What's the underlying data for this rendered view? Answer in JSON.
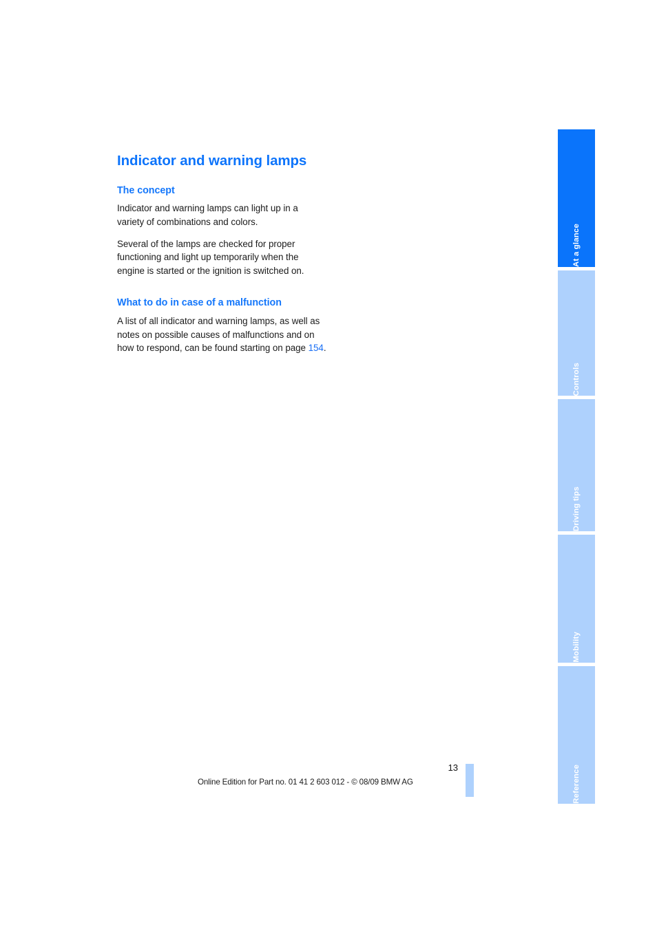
{
  "document": {
    "title": "Indicator and warning lamps",
    "sections": [
      {
        "heading": "The concept",
        "paragraphs": [
          "Indicator and warning lamps can light up in a variety of combinations and colors.",
          "Several of the lamps are checked for proper functioning and light up temporarily when the engine is started or the ignition is switched on."
        ]
      },
      {
        "heading": "What to do in case of a malfunction",
        "paragraph_lead": "A list of all indicator and warning lamps, as well as notes on possible causes of malfunctions and on how to respond, can be found starting on page ",
        "paragraph_ref": "154",
        "paragraph_tail": "."
      }
    ]
  },
  "footer": {
    "page_number": "13",
    "note": "Online Edition for Part no. 01 41 2 603 012 - © 08/09 BMW AG"
  },
  "tabs": [
    {
      "label": "At a glance",
      "active": true
    },
    {
      "label": "Controls",
      "active": false
    },
    {
      "label": "Driving tips",
      "active": false
    },
    {
      "label": "Mobility",
      "active": false
    },
    {
      "label": "Reference",
      "active": false
    }
  ],
  "colors": {
    "accent_blue": "#0d74fb",
    "sub_head_blue": "#1477fb",
    "tab_active": "#0a74fb",
    "tab_inactive": "#aed1fd",
    "body_text": "#1b1b1b",
    "link_blue": "#1a6ff5"
  }
}
